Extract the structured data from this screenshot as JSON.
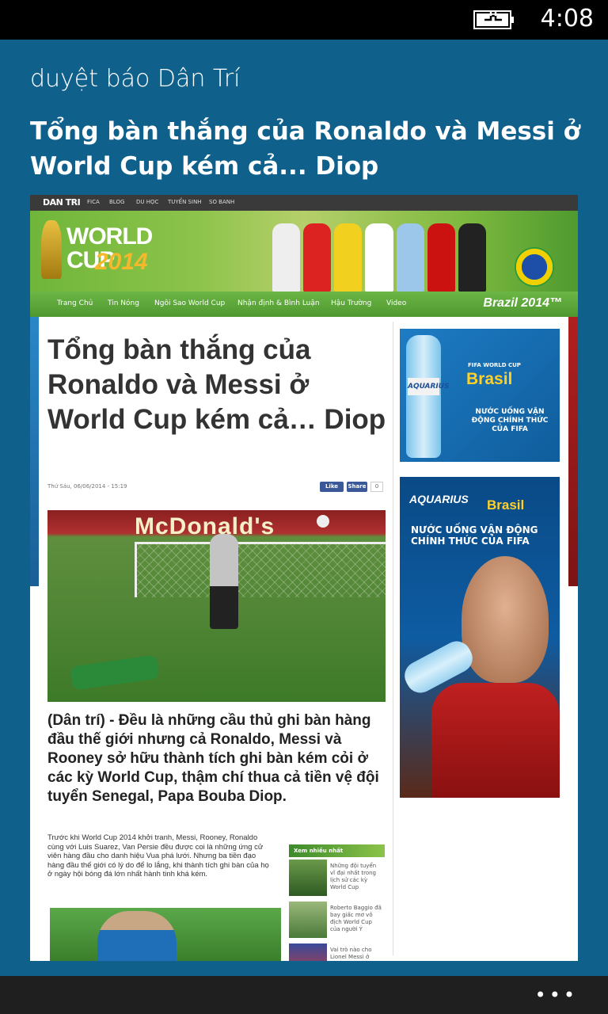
{
  "status_bar": {
    "time": "4:08"
  },
  "app": {
    "title": "duyệt báo Dân Trí",
    "article_title": "Tổng bàn thắng của Ronaldo và Messi ở World Cup kém cả... Diop"
  },
  "site": {
    "logo": "DAN TRI",
    "top_nav": [
      "FICA",
      "BLOG",
      "DU HỌC",
      "TUYỂN SINH",
      "SO BANH"
    ],
    "banner": {
      "world": "WORLD",
      "cup": "CUP",
      "year": "2014"
    },
    "main_nav": [
      "Trang Chủ",
      "Tin Nóng",
      "Ngôi Sao World Cup",
      "Nhận định & Bình Luận",
      "Hậu Trường",
      "Video"
    ],
    "brazil_label": "Brazil 2014™"
  },
  "article": {
    "title": "Tổng bàn thắng của Ronaldo và Messi ở World Cup kém cả… Diop",
    "date": "Thứ Sáu, 06/06/2014 - 15:19",
    "like_label": "Like",
    "share_label": "Share",
    "share_count": "0",
    "photo_ad_text": "McDonald's",
    "lead": "(Dân trí) - Đều là những cầu thủ ghi bàn hàng đầu thế giới nhưng cả Ronaldo, Messi và Rooney sở hữu thành tích ghi bàn kém cỏi ở các kỳ World Cup, thậm chí thua cả tiền vệ đội tuyển Senegal, Papa Bouba Diop.",
    "body": "Trước khi World Cup 2014 khởi tranh, Messi, Rooney, Ronaldo cùng với Luis Suarez, Van Persie đều được coi là những ứng cử viên hàng đầu cho danh hiệu Vua phá lưới. Nhưng ba tiền đạo hàng đầu thế giới có lý do để lo lắng, khi thành tích ghi bàn của họ ở ngày hội bóng đá lớn nhất hành tinh khá kém."
  },
  "xem_nhieu": {
    "heading": "Xem nhiều nhất",
    "items": [
      "Những đội tuyển vĩ đại nhất trong lịch sử các kỳ World Cup",
      "Roberto Baggio đã bay giấc mơ vô địch World Cup của người Ý",
      "Vai trò nào cho Lionel Messi ở"
    ]
  },
  "ads": {
    "ad1": {
      "brand": "AQUARIUS",
      "fifa": "FIFA WORLD CUP",
      "brasil": "Brasil",
      "slogan": "NƯỚC UỐNG VẬN ĐỘNG CHÍNH THỨC CỦA FIFA"
    },
    "ad2": {
      "brand": "AQUARIUS",
      "brasil": "Brasil",
      "slogan": "NƯỚC UỐNG VẬN ĐỘNG CHÍNH THỨC CỦA FIFA"
    }
  },
  "app_bar": {
    "more_label": "•••"
  }
}
